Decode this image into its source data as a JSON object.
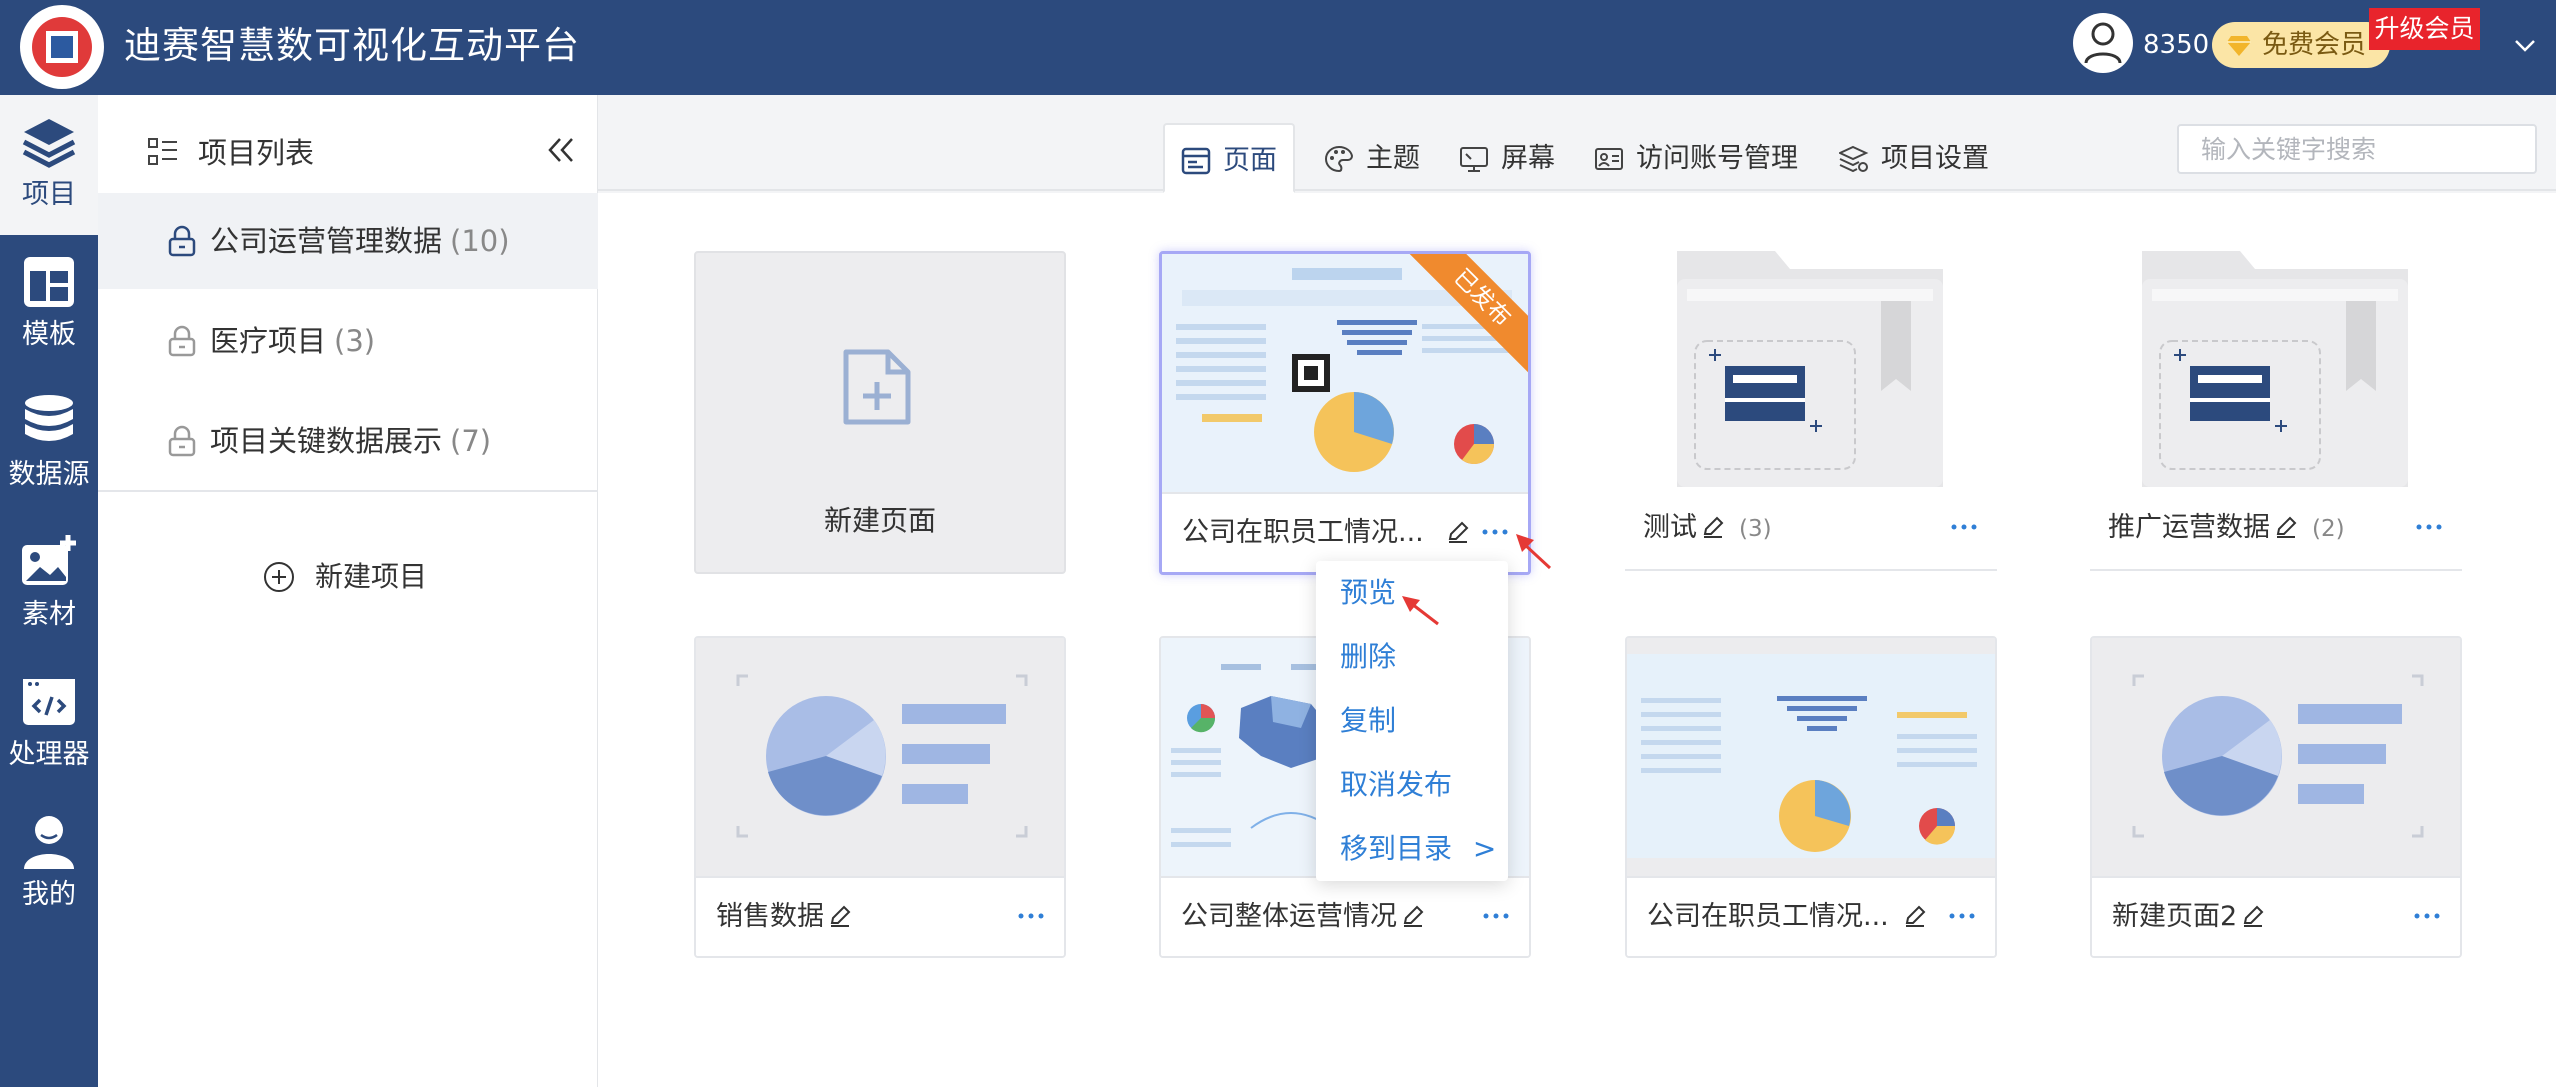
{
  "header": {
    "app_title": "迪赛智慧数可视化互动平台",
    "points": "8350",
    "member_label": "免费会员",
    "upgrade_label": "升级会员"
  },
  "rail": {
    "items": [
      {
        "label": "项目",
        "icon": "layers-icon",
        "active": true
      },
      {
        "label": "模板",
        "icon": "template-icon"
      },
      {
        "label": "数据源",
        "icon": "database-icon"
      },
      {
        "label": "素材",
        "icon": "image-add-icon"
      },
      {
        "label": "处理器",
        "icon": "code-icon"
      },
      {
        "label": "我的",
        "icon": "user-icon"
      }
    ]
  },
  "panel": {
    "title": "项目列表",
    "projects": [
      {
        "name": "公司运营管理数据",
        "count": "(10)",
        "active": true
      },
      {
        "name": "医疗项目",
        "count": "(3)"
      },
      {
        "name": "项目关键数据展示",
        "count": "(7)"
      }
    ],
    "new_project_label": "新建项目"
  },
  "tabs": [
    {
      "label": "页面",
      "icon": "page-icon",
      "active": true
    },
    {
      "label": "主题",
      "icon": "palette-icon"
    },
    {
      "label": "屏幕",
      "icon": "screen-icon"
    },
    {
      "label": "访问账号管理",
      "icon": "account-icon"
    },
    {
      "label": "项目设置",
      "icon": "settings-layers-icon"
    }
  ],
  "search": {
    "placeholder": "输入关键字搜索"
  },
  "cards": {
    "new_page_label": "新建页面",
    "items": [
      {
        "title": "公司在职员工情况...",
        "badge": "已发布",
        "kind": "dashboard",
        "selected": true
      },
      {
        "title": "测试",
        "count": "(3)",
        "kind": "folder"
      },
      {
        "title": "推广运营数据",
        "count": "(2)",
        "kind": "folder"
      },
      {
        "title": "销售数据",
        "kind": "placeholder"
      },
      {
        "title": "公司整体运营情况",
        "kind": "dashboard-map"
      },
      {
        "title": "公司在职员工情况...",
        "kind": "dashboard-chart"
      },
      {
        "title": "新建页面2",
        "kind": "placeholder"
      }
    ]
  },
  "menu": {
    "items": [
      "预览",
      "删除",
      "复制",
      "取消发布",
      "移到目录"
    ],
    "submenu_arrow": ">"
  },
  "colors": {
    "header_bg": "#2c4a7d",
    "link": "#2f7fd6",
    "badge_orange": "#f08a2e",
    "upgrade_red": "#e8242c"
  }
}
